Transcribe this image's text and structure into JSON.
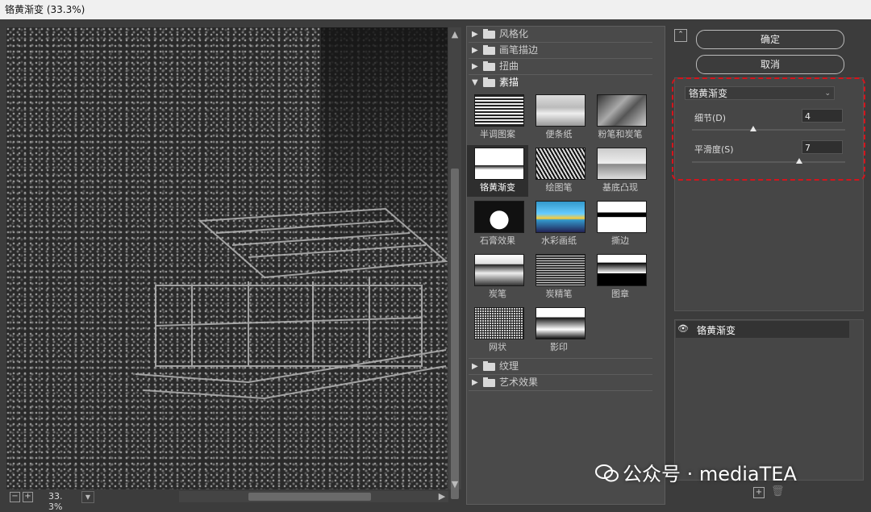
{
  "window": {
    "title": "铬黄渐变 (33.3%)"
  },
  "preview": {
    "zoom": "33. 3%"
  },
  "gallery": {
    "categories_top": [
      "风格化",
      "画笔描边",
      "扭曲"
    ],
    "open_category": "素描",
    "filters": [
      {
        "label": "半调图案",
        "icon": "halftone-thumb"
      },
      {
        "label": "便条纸",
        "icon": "note-paper-thumb"
      },
      {
        "label": "粉笔和炭笔",
        "icon": "chalk-charcoal-thumb"
      },
      {
        "label": "铬黄渐变",
        "icon": "chrome-thumb",
        "selected": true
      },
      {
        "label": "绘图笔",
        "icon": "graphic-pen-thumb"
      },
      {
        "label": "基底凸现",
        "icon": "bas-relief-thumb"
      },
      {
        "label": "石膏效果",
        "icon": "plaster-thumb"
      },
      {
        "label": "水彩画纸",
        "icon": "water-paper-thumb"
      },
      {
        "label": "撕边",
        "icon": "torn-edges-thumb"
      },
      {
        "label": "炭笔",
        "icon": "charcoal-thumb"
      },
      {
        "label": "炭精笔",
        "icon": "conte-crayon-thumb"
      },
      {
        "label": "图章",
        "icon": "stamp-thumb"
      },
      {
        "label": "网状",
        "icon": "reticulation-thumb"
      },
      {
        "label": "影印",
        "icon": "photocopy-thumb"
      }
    ],
    "categories_bottom": [
      "纹理",
      "艺术效果"
    ]
  },
  "panel": {
    "ok_label": "确定",
    "cancel_label": "取消",
    "filter_select": "铬黄渐变",
    "detail_label": "细节(D)",
    "detail_value": "4",
    "detail_fraction": 0.4,
    "smooth_label": "平滑度(S)",
    "smooth_value": "7",
    "smooth_fraction": 0.7
  },
  "layers": {
    "items": [
      "铬黄渐变"
    ]
  },
  "watermark": "公众号 · mediaTEA"
}
